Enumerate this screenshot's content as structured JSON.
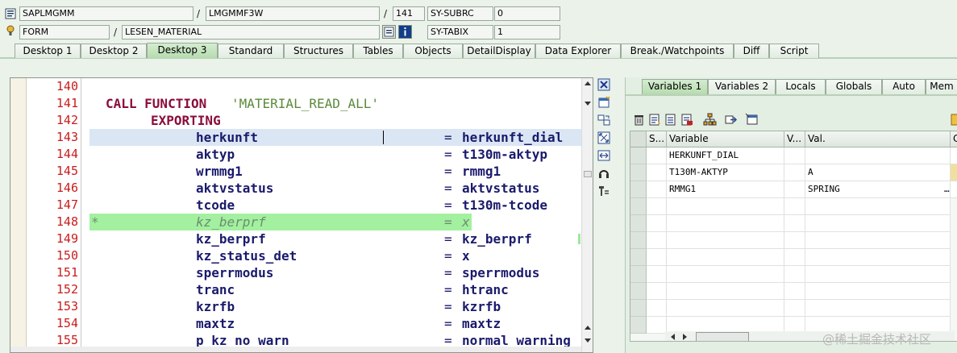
{
  "header": {
    "row1": {
      "program": "SAPLMGMM",
      "sep1": "/",
      "include": "LMGMMF3W",
      "sep2": "/",
      "line": "141",
      "sysfield": "SY-SUBRC",
      "sysvalue": "0"
    },
    "row2": {
      "event_type": "FORM",
      "sep1": "/",
      "event_name": "LESEN_MATERIAL",
      "sysfield": "SY-TABIX",
      "sysvalue": "1"
    }
  },
  "tabs": [
    {
      "label": "Desktop 1"
    },
    {
      "label": "Desktop 2"
    },
    {
      "label": "Desktop 3"
    },
    {
      "label": "Standard"
    },
    {
      "label": "Structures"
    },
    {
      "label": "Tables"
    },
    {
      "label": "Objects"
    },
    {
      "label": "DetailDisplay"
    },
    {
      "label": "Data Explorer"
    },
    {
      "label": "Break./Watchpoints"
    },
    {
      "label": "Diff"
    },
    {
      "label": "Script"
    }
  ],
  "active_tab": "Desktop 3",
  "editor": {
    "current_line": "141",
    "line_numbers": [
      "140",
      "141",
      "142",
      "143",
      "144",
      "145",
      "146",
      "147",
      "148",
      "149",
      "150",
      "151",
      "152",
      "153",
      "154",
      "155"
    ],
    "lines": [
      {
        "param": "",
        "eq": "",
        "value": ""
      },
      {
        "kw1": "CALL FUNCTION",
        "str": "'MATERIAL_READ_ALL'"
      },
      {
        "kw2": "EXPORTING"
      },
      {
        "param": "herkunft",
        "eq": "=",
        "value": "herkunft_dial"
      },
      {
        "param": "aktyp",
        "eq": "=",
        "value": "t130m-aktyp"
      },
      {
        "param": "wrmmg1",
        "eq": "=",
        "value": "rmmg1"
      },
      {
        "param": "aktvstatus",
        "eq": "=",
        "value": "aktvstatus"
      },
      {
        "param": "tcode",
        "eq": "=",
        "value": "t130m-tcode"
      },
      {
        "marker": "*",
        "param": "kz_berprf",
        "eq": "=",
        "value": "x"
      },
      {
        "param": "kz_berprf",
        "eq": "=",
        "value": "kz_berprf"
      },
      {
        "param": "kz_status_det",
        "eq": "=",
        "value": "x"
      },
      {
        "param": "sperrmodus",
        "eq": "=",
        "value": "sperrmodus"
      },
      {
        "param": "tranc",
        "eq": "=",
        "value": "htranc"
      },
      {
        "param": "kzrfb",
        "eq": "=",
        "value": "kzrfb"
      },
      {
        "param": "maxtz",
        "eq": "=",
        "value": "maxtz"
      },
      {
        "param": "p kz no warn",
        "eq": "=",
        "value": "normal warning"
      }
    ]
  },
  "right_panel": {
    "tabs": [
      {
        "label": "Variables 1"
      },
      {
        "label": "Variables 2"
      },
      {
        "label": "Locals"
      },
      {
        "label": "Globals"
      },
      {
        "label": "Auto"
      },
      {
        "label": "Mem"
      }
    ],
    "active_tab": "Variables 1",
    "columns": {
      "s": "S...",
      "variable": "Variable",
      "v": "V...",
      "val": "Val.",
      "c": "C"
    },
    "rows": [
      {
        "variable": "HERKUNFT_DIAL",
        "val": ""
      },
      {
        "variable": "T130M-AKTYP",
        "val": "A"
      },
      {
        "variable": "RMMG1",
        "val": "SPRING",
        "more": "…"
      }
    ]
  },
  "watermark": "@稀土掘金技术社区",
  "colors": {
    "active_tab": "#b6dcae",
    "line_number": "#c81c1c",
    "keyword": "#8a0d3c",
    "comment_bg": "#a3f0a0",
    "current_line_bg": "#dbe6f4"
  }
}
